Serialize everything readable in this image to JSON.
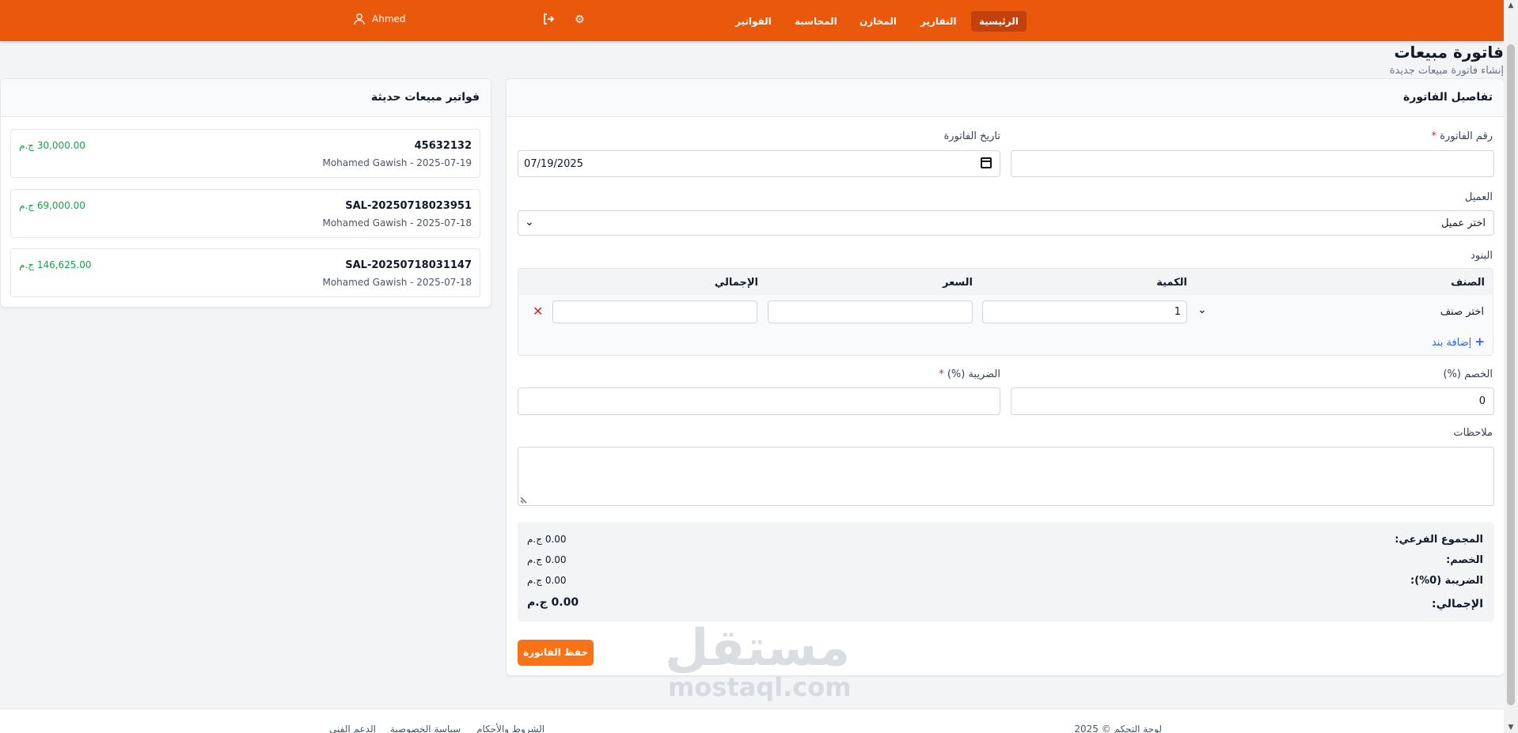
{
  "nav": {
    "items": [
      "الرئيسية",
      "التقارير",
      "المخازن",
      "المحاسبة",
      "الفواتير"
    ],
    "user": "Ahmed",
    "icons": [
      "settings-icon",
      "logout-icon",
      "user-icon"
    ]
  },
  "page": {
    "title": "فاتورة مبيعات",
    "subtitle": "إنشاء فاتورة مبيعات جديدة"
  },
  "recent": {
    "title": "فواتير مبيعات حديثة",
    "items": [
      {
        "number": "45632132",
        "meta": "Mohamed Gawish - 2025-07-19",
        "amount": "30,000.00 ج.م"
      },
      {
        "number": "SAL-20250718023951",
        "meta": "Mohamed Gawish - 2025-07-18",
        "amount": "69,000.00 ج.م"
      },
      {
        "number": "SAL-20250718031147",
        "meta": "Mohamed Gawish - 2025-07-18",
        "amount": "146,625.00 ج.م"
      }
    ]
  },
  "form": {
    "title": "تفاصيل الفاتورة",
    "invoice_number_label": "رقم الفاتورة",
    "invoice_number_value": "",
    "date_label": "تاريخ الفاتورة",
    "date_value": "07/19/2025",
    "customer_label": "العميل",
    "customer_value": "اختر عميل",
    "items_label": "البنود",
    "columns": {
      "item": "الصنف",
      "qty": "الكمية",
      "price": "السعر",
      "total": "الإجمالي"
    },
    "row": {
      "item": "اختر صنف",
      "qty": "1",
      "price": "",
      "total": ""
    },
    "add_line": "إضافة بند",
    "discount_label": "الخصم (%)",
    "discount_value": "0",
    "tax_label": "الضريبة (%)",
    "tax_value": "",
    "notes_label": "ملاحظات",
    "notes_value": ""
  },
  "totals": {
    "subtotal_label": "المجموع الفرعي:",
    "subtotal_value": "0.00 ج.م",
    "discount_label": "الخصم:",
    "discount_value": "0.00 ج.م",
    "tax_label": "الضريبة (0%):",
    "tax_value": "0.00 ج.م",
    "grand_label": "الإجمالي:",
    "grand_value": "0.00 ج.م"
  },
  "save_button": "حفظ الفاتورة",
  "watermark": {
    "ar": "مستقل",
    "en": "mostaql.com"
  },
  "footer": {
    "copyright": "لوحة التحكم © 2025",
    "links": [
      "الشروط والأحكام",
      "سياسة الخصوصية",
      "الدعم الفني"
    ]
  },
  "colors": {
    "primary": "#ea580c",
    "button": "#f97316",
    "success": "#16a34a",
    "link": "#2563eb"
  }
}
